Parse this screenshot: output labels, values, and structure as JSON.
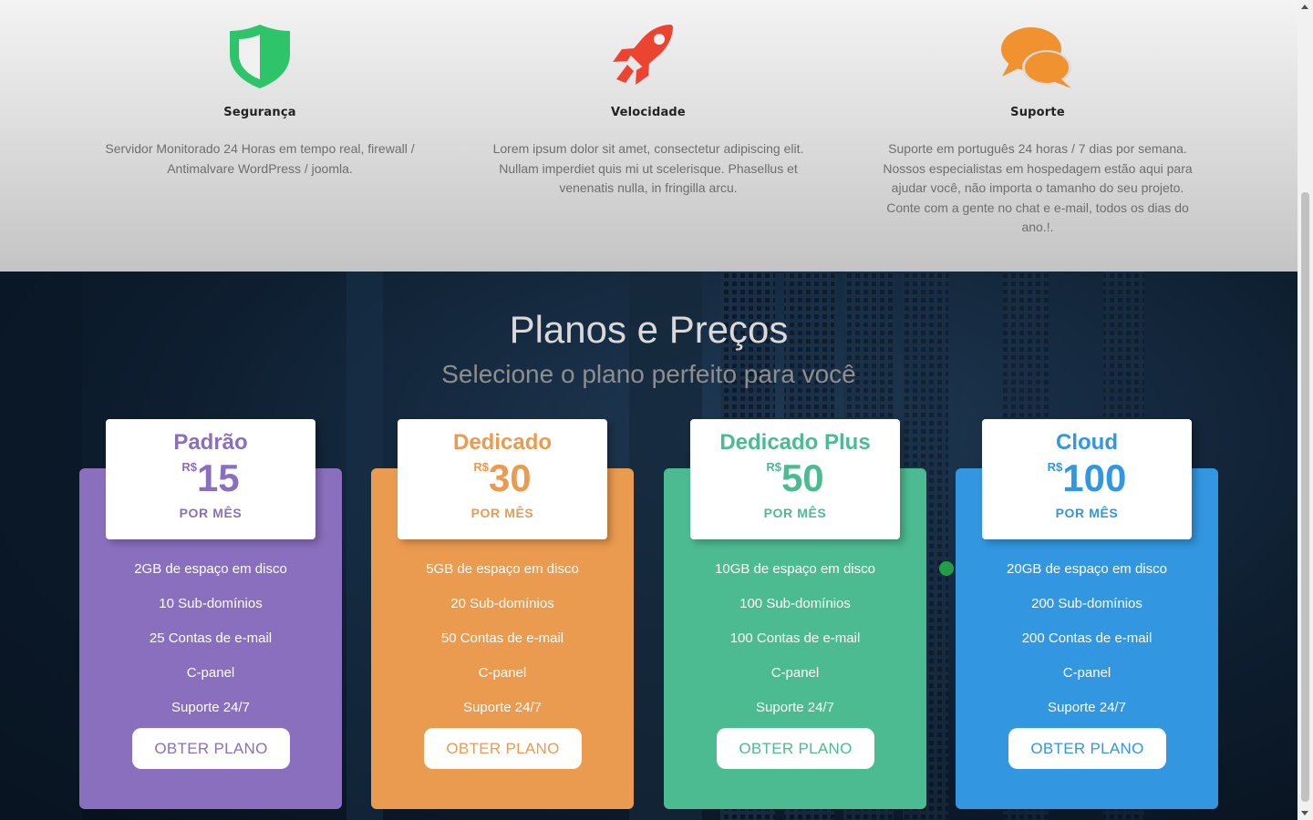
{
  "colors": {
    "padrao": "#8a6fbf",
    "dedicado": "#eb9b50",
    "dedicado_plus": "#4dbb92",
    "cloud": "#3297e0",
    "shield": "#2ec56a",
    "rocket": "#ec4431",
    "chat": "#f0922f"
  },
  "features": [
    {
      "icon": "shield-icon",
      "title": "Segurança",
      "text": "Servidor Monitorado 24 Horas em tempo real, firewall / Antimalvare WordPress / joomla."
    },
    {
      "icon": "rocket-icon",
      "title": "Velocidade",
      "text": "Lorem ipsum dolor sit amet, consectetur adipiscing elit. Nullam imperdiet quis mi ut scelerisque. Phasellus et venenatis nulla, in fringilla arcu."
    },
    {
      "icon": "chat-bubbles-icon",
      "title": "Suporte",
      "text": "Suporte em português 24 horas / 7 dias por semana. Nossos especialistas em hospedagem estão aqui para ajudar você, não importa o tamanho do seu projeto. Conte com a gente no chat e e-mail, todos os dias do ano.!."
    }
  ],
  "pricing": {
    "title": "Planos e Preços",
    "subtitle": "Selecione o plano perfeito para você",
    "plans": [
      {
        "name": "Padrão",
        "currency": "R$",
        "amount": "15",
        "period": "POR MÊS",
        "features": [
          "2GB de espaço em disco",
          "10 Sub-domínios",
          "25 Contas de e-mail",
          "C-panel",
          "Suporte 24/7"
        ],
        "button": "OBTER PLANO"
      },
      {
        "name": "Dedicado",
        "currency": "R$",
        "amount": "30",
        "period": "POR MÊS",
        "features": [
          "5GB de espaço em disco",
          "20 Sub-domínios",
          "50 Contas de e-mail",
          "C-panel",
          "Suporte 24/7"
        ],
        "button": "OBTER PLANO"
      },
      {
        "name": "Dedicado Plus",
        "currency": "R$",
        "amount": "50",
        "period": "POR MÊS",
        "features": [
          "10GB de espaço em disco",
          "100 Sub-domínios",
          "100 Contas de e-mail",
          "C-panel",
          "Suporte 24/7"
        ],
        "button": "OBTER PLANO"
      },
      {
        "name": "Cloud",
        "currency": "R$",
        "amount": "100",
        "period": "POR MÊS",
        "features": [
          "20GB de espaço em disco",
          "200 Sub-domínios",
          "200 Contas de e-mail",
          "C-panel",
          "Suporte 24/7"
        ],
        "button": "OBTER PLANO"
      }
    ]
  }
}
